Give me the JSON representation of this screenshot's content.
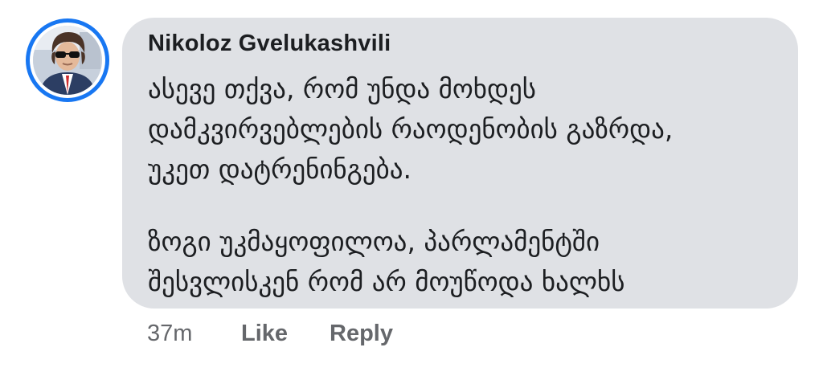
{
  "comment": {
    "author": "Nikoloz Gvelukashvili",
    "lines": [
      "ასევე თქვა, რომ უნდა მოხდეს",
      "დამკვირვებლების რაოდენობის გაზრდა,",
      "უკეთ დატრენინგება.",
      "ზოგი უკმაყოფილოა, პარლამენტში",
      "შესვლისკენ რომ არ მოუწოდა ხალხს"
    ]
  },
  "actions": {
    "time": "37m",
    "like": "Like",
    "reply": "Reply"
  },
  "colors": {
    "avatar_ring": "#1877f2",
    "bubble": "#dfe1e5",
    "text": "#1c1e21",
    "secondary_text": "#65676b"
  },
  "icons": {
    "avatar": "profile-photo"
  }
}
